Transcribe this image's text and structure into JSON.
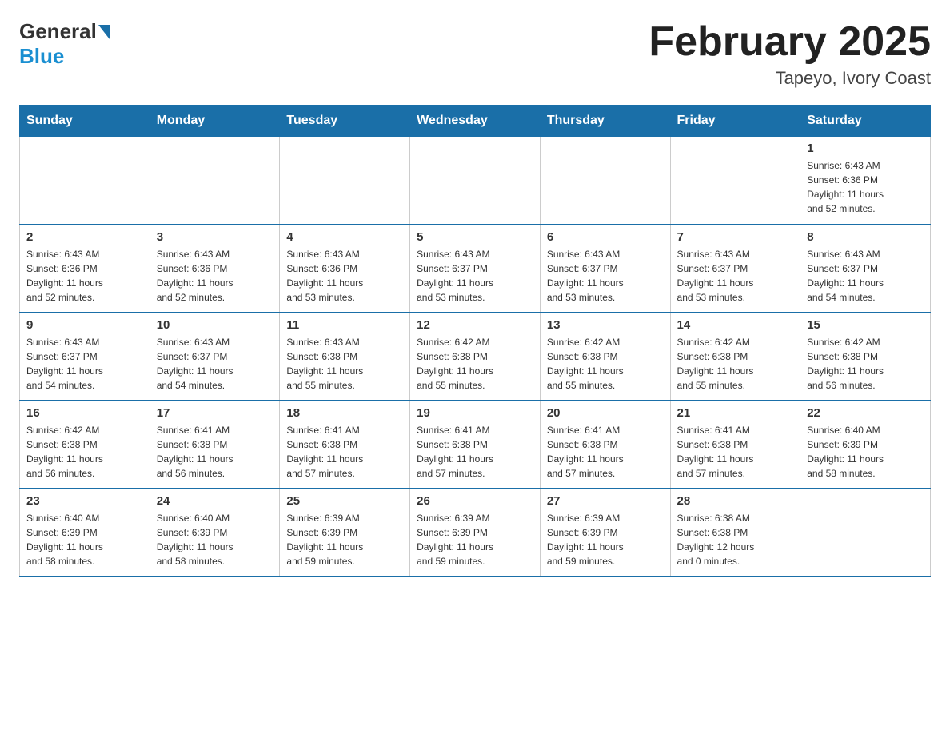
{
  "header": {
    "logo_general": "General",
    "logo_blue": "Blue",
    "title": "February 2025",
    "subtitle": "Tapeyo, Ivory Coast"
  },
  "weekdays": [
    "Sunday",
    "Monday",
    "Tuesday",
    "Wednesday",
    "Thursday",
    "Friday",
    "Saturday"
  ],
  "weeks": [
    [
      {
        "day": "",
        "info": ""
      },
      {
        "day": "",
        "info": ""
      },
      {
        "day": "",
        "info": ""
      },
      {
        "day": "",
        "info": ""
      },
      {
        "day": "",
        "info": ""
      },
      {
        "day": "",
        "info": ""
      },
      {
        "day": "1",
        "info": "Sunrise: 6:43 AM\nSunset: 6:36 PM\nDaylight: 11 hours\nand 52 minutes."
      }
    ],
    [
      {
        "day": "2",
        "info": "Sunrise: 6:43 AM\nSunset: 6:36 PM\nDaylight: 11 hours\nand 52 minutes."
      },
      {
        "day": "3",
        "info": "Sunrise: 6:43 AM\nSunset: 6:36 PM\nDaylight: 11 hours\nand 52 minutes."
      },
      {
        "day": "4",
        "info": "Sunrise: 6:43 AM\nSunset: 6:36 PM\nDaylight: 11 hours\nand 53 minutes."
      },
      {
        "day": "5",
        "info": "Sunrise: 6:43 AM\nSunset: 6:37 PM\nDaylight: 11 hours\nand 53 minutes."
      },
      {
        "day": "6",
        "info": "Sunrise: 6:43 AM\nSunset: 6:37 PM\nDaylight: 11 hours\nand 53 minutes."
      },
      {
        "day": "7",
        "info": "Sunrise: 6:43 AM\nSunset: 6:37 PM\nDaylight: 11 hours\nand 53 minutes."
      },
      {
        "day": "8",
        "info": "Sunrise: 6:43 AM\nSunset: 6:37 PM\nDaylight: 11 hours\nand 54 minutes."
      }
    ],
    [
      {
        "day": "9",
        "info": "Sunrise: 6:43 AM\nSunset: 6:37 PM\nDaylight: 11 hours\nand 54 minutes."
      },
      {
        "day": "10",
        "info": "Sunrise: 6:43 AM\nSunset: 6:37 PM\nDaylight: 11 hours\nand 54 minutes."
      },
      {
        "day": "11",
        "info": "Sunrise: 6:43 AM\nSunset: 6:38 PM\nDaylight: 11 hours\nand 55 minutes."
      },
      {
        "day": "12",
        "info": "Sunrise: 6:42 AM\nSunset: 6:38 PM\nDaylight: 11 hours\nand 55 minutes."
      },
      {
        "day": "13",
        "info": "Sunrise: 6:42 AM\nSunset: 6:38 PM\nDaylight: 11 hours\nand 55 minutes."
      },
      {
        "day": "14",
        "info": "Sunrise: 6:42 AM\nSunset: 6:38 PM\nDaylight: 11 hours\nand 55 minutes."
      },
      {
        "day": "15",
        "info": "Sunrise: 6:42 AM\nSunset: 6:38 PM\nDaylight: 11 hours\nand 56 minutes."
      }
    ],
    [
      {
        "day": "16",
        "info": "Sunrise: 6:42 AM\nSunset: 6:38 PM\nDaylight: 11 hours\nand 56 minutes."
      },
      {
        "day": "17",
        "info": "Sunrise: 6:41 AM\nSunset: 6:38 PM\nDaylight: 11 hours\nand 56 minutes."
      },
      {
        "day": "18",
        "info": "Sunrise: 6:41 AM\nSunset: 6:38 PM\nDaylight: 11 hours\nand 57 minutes."
      },
      {
        "day": "19",
        "info": "Sunrise: 6:41 AM\nSunset: 6:38 PM\nDaylight: 11 hours\nand 57 minutes."
      },
      {
        "day": "20",
        "info": "Sunrise: 6:41 AM\nSunset: 6:38 PM\nDaylight: 11 hours\nand 57 minutes."
      },
      {
        "day": "21",
        "info": "Sunrise: 6:41 AM\nSunset: 6:38 PM\nDaylight: 11 hours\nand 57 minutes."
      },
      {
        "day": "22",
        "info": "Sunrise: 6:40 AM\nSunset: 6:39 PM\nDaylight: 11 hours\nand 58 minutes."
      }
    ],
    [
      {
        "day": "23",
        "info": "Sunrise: 6:40 AM\nSunset: 6:39 PM\nDaylight: 11 hours\nand 58 minutes."
      },
      {
        "day": "24",
        "info": "Sunrise: 6:40 AM\nSunset: 6:39 PM\nDaylight: 11 hours\nand 58 minutes."
      },
      {
        "day": "25",
        "info": "Sunrise: 6:39 AM\nSunset: 6:39 PM\nDaylight: 11 hours\nand 59 minutes."
      },
      {
        "day": "26",
        "info": "Sunrise: 6:39 AM\nSunset: 6:39 PM\nDaylight: 11 hours\nand 59 minutes."
      },
      {
        "day": "27",
        "info": "Sunrise: 6:39 AM\nSunset: 6:39 PM\nDaylight: 11 hours\nand 59 minutes."
      },
      {
        "day": "28",
        "info": "Sunrise: 6:38 AM\nSunset: 6:38 PM\nDaylight: 12 hours\nand 0 minutes."
      },
      {
        "day": "",
        "info": ""
      }
    ]
  ]
}
